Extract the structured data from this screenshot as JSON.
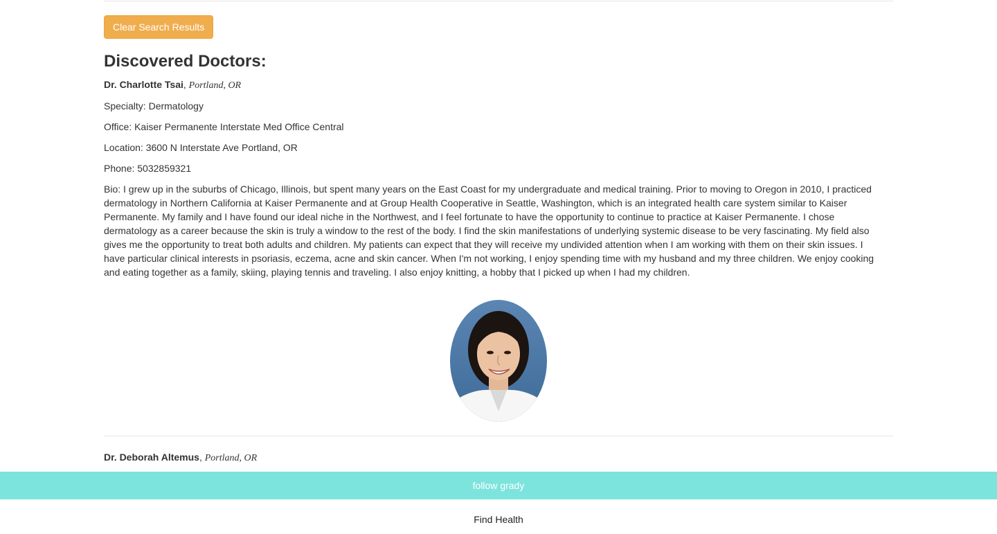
{
  "actions": {
    "clear_button_label": "Clear Search Results"
  },
  "results": {
    "title": "Discovered Doctors:",
    "doctors": [
      {
        "name": "Dr. Charlotte Tsai",
        "separator": ", ",
        "city": "Portland, OR",
        "specialty": "Specialty: Dermatology",
        "office": "Office: Kaiser Permanente Interstate Med Office Central",
        "location": "Location: 3600 N Interstate Ave Portland, OR",
        "phone": "Phone: 5032859321",
        "bio": "Bio: I grew up in the suburbs of Chicago, Illinois, but spent many years on the East Coast for my undergraduate and medical training. Prior to moving to Oregon in 2010, I practiced dermatology in Northern California at Kaiser Permanente and at Group Health Cooperative in Seattle, Washington, which is an integrated health care system similar to Kaiser Permanente. My family and I have found our ideal niche in the Northwest, and I feel fortunate to have the opportunity to continue to practice at Kaiser Permanente. I chose dermatology as a career because the skin is truly a window to the rest of the body. I find the skin manifestations of underlying systemic disease to be very fascinating. My field also gives me the opportunity to treat both adults and children. My patients can expect that they will receive my undivided attention when I am working with them on their skin issues. I have particular clinical interests in psoriasis, eczema, acne and skin cancer. When I'm not working, I enjoy spending time with my husband and my three children. We enjoy cooking and eating together as a family, skiing, playing tennis and traveling. I also enjoy knitting, a hobby that I picked up when I had my children."
      },
      {
        "name": "Dr. Deborah Altemus",
        "separator": ", ",
        "city": "Portland, OR"
      }
    ]
  },
  "footer": {
    "follow_label": "follow grady",
    "find_health_label": "Find Health"
  },
  "colors": {
    "clear_button": "#f0ad4e",
    "follow_bar": "#7de3dd"
  }
}
